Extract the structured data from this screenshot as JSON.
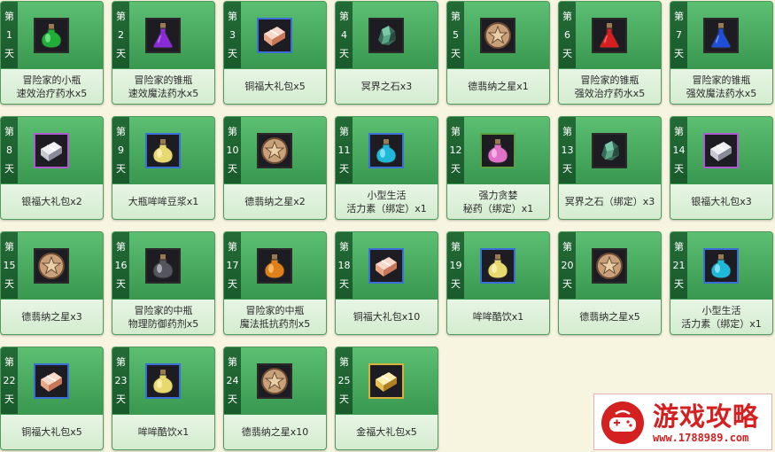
{
  "day_prefix": "第",
  "day_suffix": "天",
  "cards": [
    {
      "day": "1",
      "name": "冒险家的小瓶\n速效治疗药水x5",
      "icon": "green-potion-icon",
      "quality": ""
    },
    {
      "day": "2",
      "name": "冒险家的锥瓶\n速效魔法药水x5",
      "icon": "purple-potion-icon",
      "quality": ""
    },
    {
      "day": "3",
      "name": "铜福大礼包x5",
      "icon": "copper-gift-pack-icon",
      "quality": "q-blue"
    },
    {
      "day": "4",
      "name": "冥界之石x3",
      "icon": "underworld-stone-icon",
      "quality": ""
    },
    {
      "day": "5",
      "name": "德翡纳之星x1",
      "icon": "star-medal-icon",
      "quality": ""
    },
    {
      "day": "6",
      "name": "冒险家的锥瓶\n强效治疗药水x5",
      "icon": "red-potion-icon",
      "quality": ""
    },
    {
      "day": "7",
      "name": "冒险家的锥瓶\n强效魔法药水x5",
      "icon": "blue-potion-icon",
      "quality": ""
    },
    {
      "day": "8",
      "name": "银福大礼包x2",
      "icon": "silver-gift-pack-icon",
      "quality": "q-purple"
    },
    {
      "day": "9",
      "name": "大瓶哞哞豆浆x1",
      "icon": "soymilk-bottle-icon",
      "quality": "q-blue"
    },
    {
      "day": "10",
      "name": "德翡纳之星x2",
      "icon": "star-medal-icon",
      "quality": ""
    },
    {
      "day": "11",
      "name": "小型生活\n活力素（绑定）x1",
      "icon": "vitality-flask-icon",
      "quality": "q-blue"
    },
    {
      "day": "12",
      "name": "强力贪婪\n秘药（绑定）x1",
      "icon": "greed-elixir-icon",
      "quality": "q-green"
    },
    {
      "day": "13",
      "name": "冥界之石（绑定）x3",
      "icon": "underworld-stone-icon",
      "quality": ""
    },
    {
      "day": "14",
      "name": "银福大礼包x3",
      "icon": "silver-gift-pack-icon",
      "quality": "q-purple"
    },
    {
      "day": "15",
      "name": "德翡纳之星x3",
      "icon": "star-medal-icon",
      "quality": ""
    },
    {
      "day": "16",
      "name": "冒险家的中瓶\n物理防御药剂x5",
      "icon": "clear-potion-icon",
      "quality": ""
    },
    {
      "day": "17",
      "name": "冒险家的中瓶\n魔法抵抗药剂x5",
      "icon": "orange-potion-icon",
      "quality": ""
    },
    {
      "day": "18",
      "name": "铜福大礼包x10",
      "icon": "copper-gift-pack-icon",
      "quality": "q-blue"
    },
    {
      "day": "19",
      "name": "哞哞酷饮x1",
      "icon": "soymilk-bottle-icon",
      "quality": "q-blue"
    },
    {
      "day": "20",
      "name": "德翡纳之星x5",
      "icon": "star-medal-icon",
      "quality": ""
    },
    {
      "day": "21",
      "name": "小型生活\n活力素（绑定）x1",
      "icon": "vitality-flask-icon",
      "quality": "q-blue"
    },
    {
      "day": "22",
      "name": "铜福大礼包x5",
      "icon": "copper-gift-pack-icon",
      "quality": "q-blue"
    },
    {
      "day": "23",
      "name": "哞哞酷饮x1",
      "icon": "soymilk-bottle-icon",
      "quality": "q-blue"
    },
    {
      "day": "24",
      "name": "德翡纳之星x10",
      "icon": "star-medal-icon",
      "quality": ""
    },
    {
      "day": "25",
      "name": "金福大礼包x5",
      "icon": "gold-gift-pack-icon",
      "quality": "q-gold"
    }
  ],
  "watermark": {
    "title": "游戏攻略",
    "url": "www.1788989.com"
  },
  "colors": {
    "card_green": "#46a85d",
    "day_tab": "#1f6331",
    "label_bg": "#e2f2df",
    "watermark_red": "#d42020"
  }
}
